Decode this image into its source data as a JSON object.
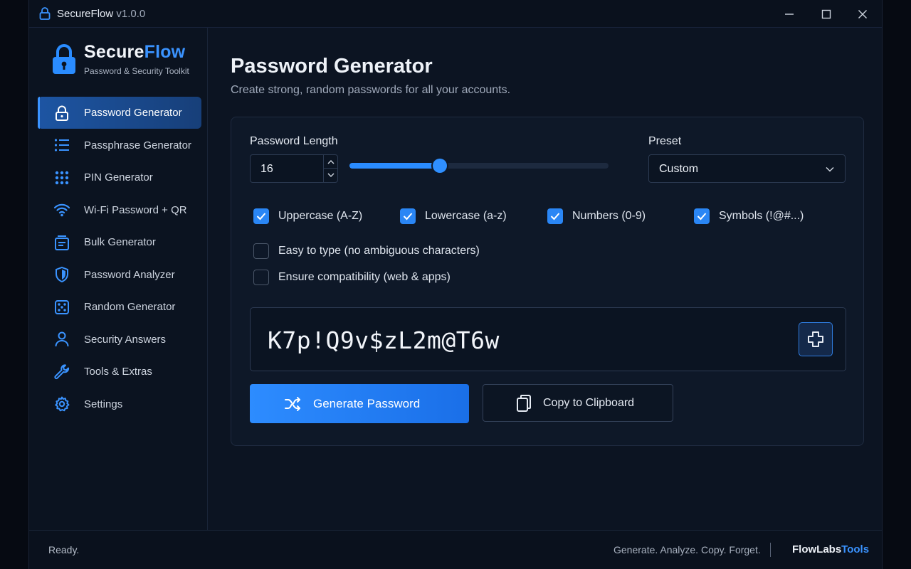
{
  "window": {
    "title": "SecureFlow",
    "version": "v1.0.0"
  },
  "sidebar": {
    "brand_part1": "Secure",
    "brand_part2": "Flow",
    "brand_subtitle": "Password & Security Toolkit",
    "items": [
      {
        "label": "Password Generator",
        "icon": "lock-icon",
        "active": true
      },
      {
        "label": "Passphrase Generator",
        "icon": "list-icon",
        "active": false
      },
      {
        "label": "PIN Generator",
        "icon": "keypad-icon",
        "active": false
      },
      {
        "label": "Wi-Fi Password + QR",
        "icon": "wifi-icon",
        "active": false
      },
      {
        "label": "Bulk Generator",
        "icon": "stack-icon",
        "active": false
      },
      {
        "label": "Password Analyzer",
        "icon": "shield-icon",
        "active": false
      },
      {
        "label": "Random Generator",
        "icon": "dice-icon",
        "active": false
      },
      {
        "label": "Security Answers",
        "icon": "user-icon",
        "active": false
      },
      {
        "label": "Tools & Extras",
        "icon": "wrench-icon",
        "active": false
      },
      {
        "label": "Settings",
        "icon": "gear-icon",
        "active": false
      }
    ]
  },
  "main": {
    "title": "Password Generator",
    "subtitle": "Create strong, random passwords for all your accounts."
  },
  "generator": {
    "length_label": "Password Length",
    "length_value": "16",
    "slider_fraction": 0.35,
    "preset_label": "Preset",
    "preset_value": "Custom",
    "options": [
      {
        "label": "Uppercase (A-Z)",
        "checked": true
      },
      {
        "label": "Lowercase (a-z)",
        "checked": true
      },
      {
        "label": "Numbers (0-9)",
        "checked": true
      },
      {
        "label": "Symbols (!@#...)",
        "checked": true
      },
      {
        "label": "Easy to type (no ambiguous characters)",
        "checked": false
      },
      {
        "label": "Ensure compatibility (web & apps)",
        "checked": false
      }
    ],
    "password": "K7p!Q9v$zL2m@T6w",
    "generate_label": "Generate Password",
    "copy_label": "Copy to Clipboard"
  },
  "statusbar": {
    "status": "Ready.",
    "tagline": "Generate. Analyze. Copy. Forget.",
    "brand_part1": "FlowLabs",
    "brand_part2": "Tools"
  },
  "colors": {
    "accent": "#2a8cff",
    "background": "#0c1422",
    "active_nav": "#1d55a3"
  }
}
